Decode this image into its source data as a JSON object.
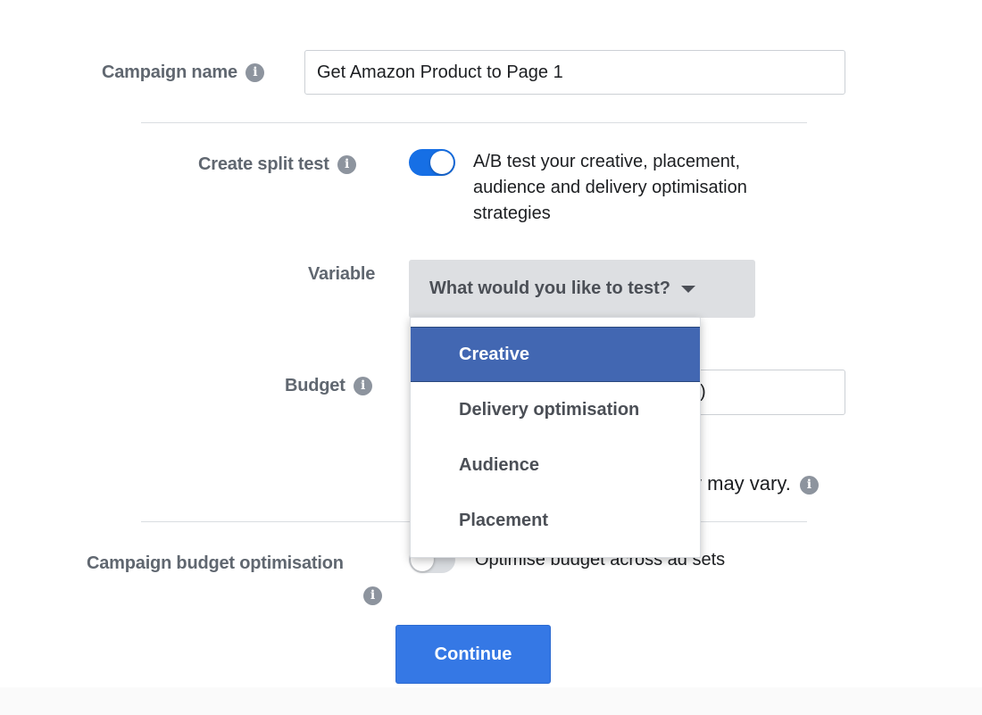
{
  "form": {
    "campaign_name": {
      "label": "Campaign name",
      "value": "Get Amazon Product to Page 1",
      "info_icon": "info-icon"
    },
    "split_test": {
      "label": "Create split test",
      "enabled": true,
      "description_lines": [
        "A/B test your creative, placement,",
        "audience and delivery optimisation",
        "strategies"
      ],
      "info_icon": "info-icon"
    },
    "variable": {
      "label": "Variable",
      "placeholder": "What would you like to test?",
      "caret_icon": "caret-down-icon",
      "menu_open": true,
      "options": [
        {
          "label": "Creative",
          "selected": true
        },
        {
          "label": "Delivery optimisation",
          "selected": false
        },
        {
          "label": "Audience",
          "selected": false
        },
        {
          "label": "Placement",
          "selected": false
        }
      ]
    },
    "budget": {
      "label": "Budget",
      "value_visible_fragment": ")",
      "note_visible_fragment": "y may vary.",
      "info_icon": "info-icon"
    },
    "campaign_budget_optimisation": {
      "label": "Campaign budget optimisation",
      "enabled": false,
      "description": "Optimise budget across ad sets",
      "info_icon": "info-icon"
    }
  },
  "actions": {
    "continue_label": "Continue"
  },
  "colors": {
    "toggle_on": "#166fe5",
    "menu_selected": "#4267b2",
    "primary_button": "#3578e5",
    "label_gray": "#606770"
  }
}
